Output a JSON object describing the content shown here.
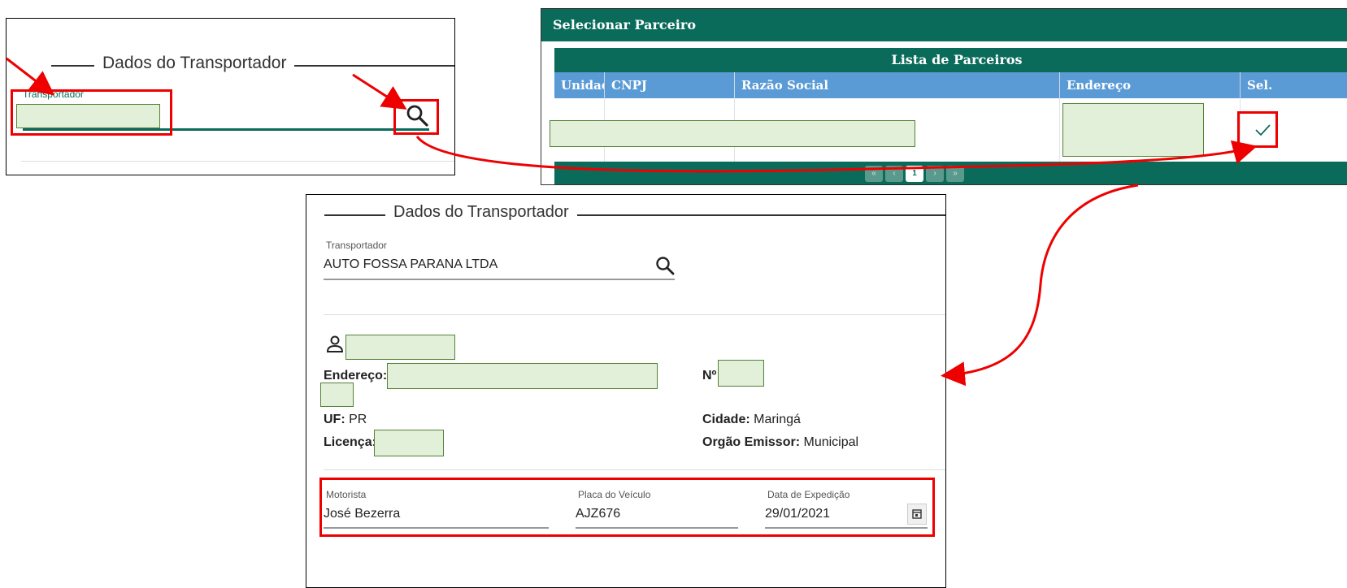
{
  "panel1": {
    "section_title": "Dados do Transportador",
    "transporter_label": "Transportador",
    "search_icon": "search-icon"
  },
  "panel2": {
    "dialog_title": "Selecionar Parceiro",
    "list_title": "Lista de Parceiros",
    "columns": [
      "Unidade",
      "CNPJ",
      "Razão Social",
      "Endereço",
      "Sel."
    ],
    "select_icon": "checkmark-icon",
    "pager_current": "1"
  },
  "panel3": {
    "section_title": "Dados do Transportador",
    "transporter_label": "Transportador",
    "transporter_value": "AUTO FOSSA PARANA LTDA",
    "address_label": "Endereço:",
    "number_label": "Nº",
    "uf_label": "UF:",
    "uf_value": "PR",
    "city_label": "Cidade:",
    "city_value": "Maringá",
    "license_label": "Licença:",
    "issuer_label": "Orgão Emissor:",
    "issuer_value": "Municipal",
    "driver_label": "Motorista",
    "driver_value": "José Bezerra",
    "plate_label": "Placa do Veículo",
    "plate_value": "AJZ676",
    "date_label": "Data de Expedição",
    "date_value": "29/01/2021"
  },
  "colors": {
    "header_green": "#0b6b5b",
    "column_blue": "#5b9bd5",
    "annotation_red": "#ee0000",
    "redaction_fill": "#e2efd9"
  }
}
